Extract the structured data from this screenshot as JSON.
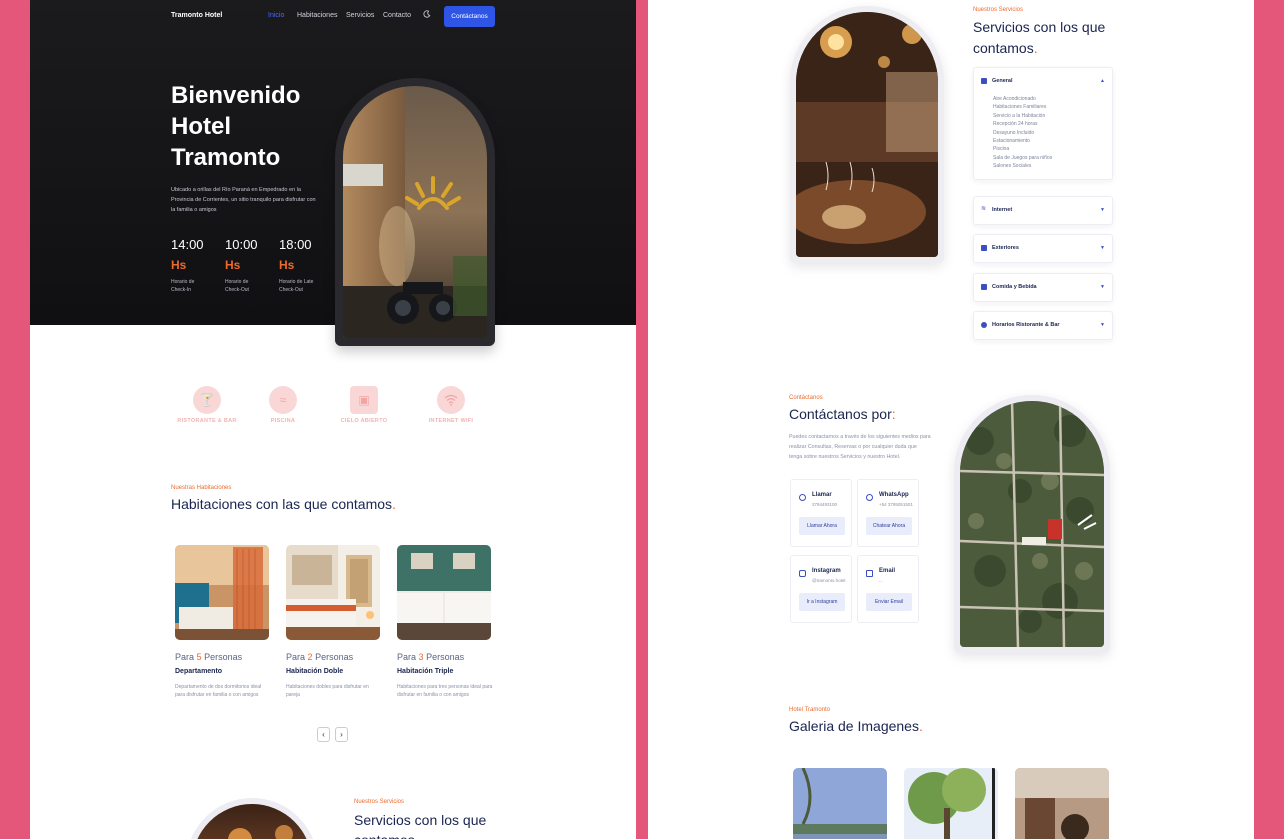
{
  "nav": {
    "brand": "Tramonto Hotel",
    "links": [
      "Inicio",
      "Habitaciones",
      "Servicios",
      "Contacto"
    ],
    "cta": "Contáctanos"
  },
  "hero": {
    "title": "Bienvenido Hotel Tramonto",
    "description": "Ubicado a orillas del Río Paraná en Empedrado en la Provincia de Corrientes, un sitio tranquilo para disfrutar con la familia o amigos",
    "hours": [
      {
        "time": "14:00",
        "unit": "Hs",
        "label": "Horario de Check-In"
      },
      {
        "time": "10:00",
        "unit": "Hs",
        "label": "Horario de Check-Out"
      },
      {
        "time": "18:00",
        "unit": "Hs",
        "label": "Horario de Late Check-Out"
      }
    ]
  },
  "features": [
    {
      "label": "RISTORANTE & BAR",
      "icon": "cocktail-icon"
    },
    {
      "label": "PISCINA",
      "icon": "pool-icon"
    },
    {
      "label": "CIELO ABIERTO",
      "icon": "window-icon"
    },
    {
      "label": "INTERNET WIFI",
      "icon": "wifi-icon"
    }
  ],
  "rooms_section": {
    "eyebrow": "Nuestras Habitaciones",
    "title": "Habitaciones con las que contamos",
    "rooms": [
      {
        "prefix": "Para",
        "count": "5",
        "suffix": "Personas",
        "name": "Departamento",
        "desc": "Departamento de dos dormitorios ideal para disfrutar en familia o con amigos"
      },
      {
        "prefix": "Para",
        "count": "2",
        "suffix": "Personas",
        "name": "Habitación Doble",
        "desc": "Habitaciones dobles para disfrutar en pareja"
      },
      {
        "prefix": "Para",
        "count": "3",
        "suffix": "Personas",
        "name": "Habitación Triple",
        "desc": "Habitaciones para tres personas ideal para disfrutar en familia o con amigos"
      }
    ],
    "prev": "‹",
    "next": "›"
  },
  "services_section": {
    "eyebrow": "Nuestros Servicios",
    "title": "Servicios con los que contamos",
    "title_cut": "Servicios con los que",
    "title_cut2": "contamos",
    "accordion": [
      {
        "title": "General",
        "open": true,
        "items": [
          "Aire Acondicionado",
          "Habitaciones Familiares",
          "Servicio a la Habitación",
          "Recepción 24 horas",
          "Desayuno Incluido",
          "Estacionamiento",
          "Piscina",
          "Sala de Juegos para niños",
          "Salones Sociales"
        ]
      },
      {
        "title": "Internet",
        "open": false
      },
      {
        "title": "Exteriores",
        "open": false
      },
      {
        "title": "Comida y Bebida",
        "open": false
      },
      {
        "title": "Horarios Ristorante & Bar",
        "open": false
      }
    ]
  },
  "contact_section": {
    "eyebrow": "Contáctanos",
    "title": "Contáctanos por",
    "description": "Puedes contactarnos a través de los siguientes medios para realizar Consultas, Reservas o por cualquier duda que tenga sobre nuestros Servicios y nuestro Hotel.",
    "cards": [
      {
        "title": "Llamar",
        "sub": "3794493100",
        "button": "Llamar Ahora",
        "icon": "phone-icon"
      },
      {
        "title": "WhatsApp",
        "sub": "+54 3795051501",
        "button": "Chatear Ahora",
        "icon": "whatsapp-icon"
      },
      {
        "title": "Instagram",
        "sub": "@tramonto.hotel",
        "button": "Ir a Instagram",
        "icon": "instagram-icon"
      },
      {
        "title": "Email",
        "sub": "...",
        "button": "Enviar Email",
        "icon": "email-icon"
      }
    ]
  },
  "gallery_section": {
    "eyebrow": "Hotel Tramonto",
    "title": "Galeria de Imagenes"
  },
  "colors": {
    "accent": "#ee6a2c",
    "primary": "#2f55e6",
    "navy": "#1a2550",
    "frame": "#e4577a"
  }
}
